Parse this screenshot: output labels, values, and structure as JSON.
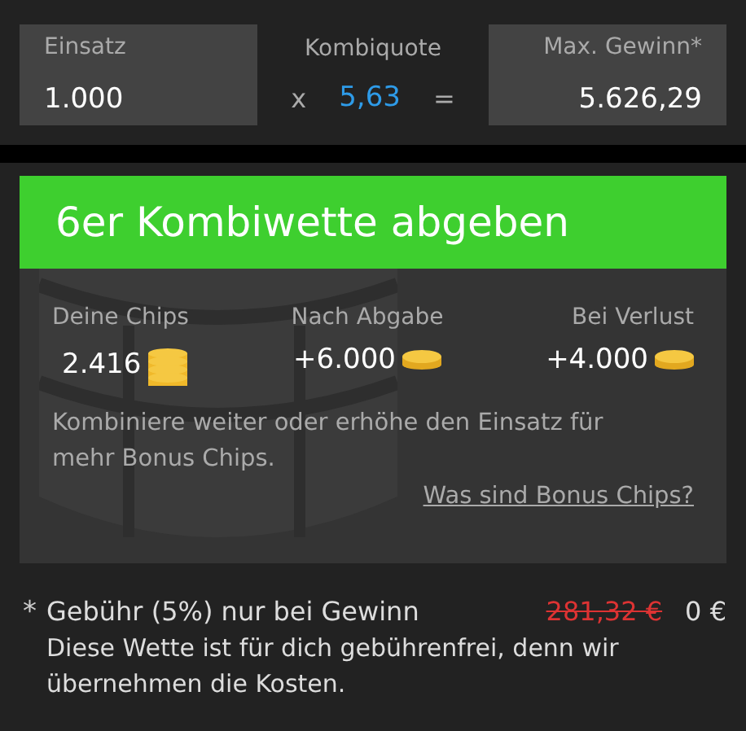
{
  "stake": {
    "label": "Einsatz",
    "value": "1.000"
  },
  "odds": {
    "label": "Kombiquote",
    "times": "x",
    "value": "5,63",
    "equals": "="
  },
  "max_win": {
    "label": "Max. Gewinn*",
    "value": "5.626,29"
  },
  "submit_button": "6er Kombiwette abgeben",
  "chips": [
    {
      "label": "Deine Chips",
      "value": "2.416",
      "kind": "stack"
    },
    {
      "label": "Nach Abgabe",
      "value": "+6.000",
      "kind": "single"
    },
    {
      "label": "Bei Verlust",
      "value": "+4.000",
      "kind": "single"
    }
  ],
  "hint": "Kombiniere weiter oder erhöhe den Einsatz für mehr Bonus Chips.",
  "info_link": "Was sind Bonus Chips?",
  "fee": {
    "asterisk": "*",
    "label": "Gebühr (5%) nur bei Gewinn",
    "old_price": "281,32 €",
    "price": "0 €",
    "note": "Diese Wette ist für dich gebührenfrei, denn wir übernehmen die Kosten."
  }
}
